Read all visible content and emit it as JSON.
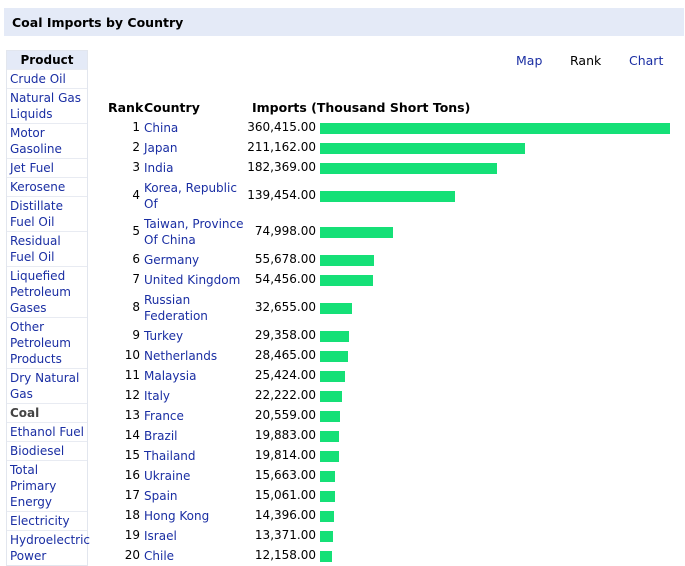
{
  "page_title": "Coal Imports by Country",
  "sidebar": {
    "header": "Product",
    "items": [
      {
        "label": "Crude Oil",
        "lines": 1
      },
      {
        "label": "Natural Gas Liquids",
        "lines": 2
      },
      {
        "label": "Motor Gasoline",
        "lines": 2
      },
      {
        "label": "Jet Fuel",
        "lines": 1
      },
      {
        "label": "Kerosene",
        "lines": 1
      },
      {
        "label": "Distillate Fuel Oil",
        "lines": 2
      },
      {
        "label": "Residual Fuel Oil",
        "lines": 2
      },
      {
        "label": "Liquefied Petroleum Gases",
        "lines": 3
      },
      {
        "label": "Other Petroleum Products",
        "lines": 3
      },
      {
        "label": "Dry Natural Gas",
        "lines": 2
      },
      {
        "label": "Coal",
        "lines": 1,
        "current": true
      },
      {
        "label": "Ethanol Fuel",
        "lines": 1
      },
      {
        "label": "Biodiesel",
        "lines": 1
      },
      {
        "label": "Total Primary Energy",
        "lines": 3
      },
      {
        "label": "Electricity",
        "lines": 1
      },
      {
        "label": "Hydroelectric Power",
        "lines": 2
      }
    ]
  },
  "view_nav": {
    "map": "Map",
    "rank": "Rank",
    "chart": "Chart",
    "active": "rank"
  },
  "table": {
    "header_rank": "Rank",
    "header_country": "Country",
    "header_imports": "Imports (Thousand Short Tons)",
    "max_value": 360415,
    "rows": [
      {
        "rank": "1",
        "country": "China",
        "value": "360,415.00",
        "v": 360415
      },
      {
        "rank": "2",
        "country": "Japan",
        "value": "211,162.00",
        "v": 211162
      },
      {
        "rank": "3",
        "country": "India",
        "value": "182,369.00",
        "v": 182369
      },
      {
        "rank": "4",
        "country": "Korea, Republic Of",
        "value": "139,454.00",
        "v": 139454,
        "lines": 2
      },
      {
        "rank": "5",
        "country": "Taiwan, Province Of China",
        "value": "74,998.00",
        "v": 74998,
        "lines": 2
      },
      {
        "rank": "6",
        "country": "Germany",
        "value": "55,678.00",
        "v": 55678
      },
      {
        "rank": "7",
        "country": "United Kingdom",
        "value": "54,456.00",
        "v": 54456
      },
      {
        "rank": "8",
        "country": "Russian Federation",
        "value": "32,655.00",
        "v": 32655,
        "lines": 2
      },
      {
        "rank": "9",
        "country": "Turkey",
        "value": "29,358.00",
        "v": 29358
      },
      {
        "rank": "10",
        "country": "Netherlands",
        "value": "28,465.00",
        "v": 28465
      },
      {
        "rank": "11",
        "country": "Malaysia",
        "value": "25,424.00",
        "v": 25424
      },
      {
        "rank": "12",
        "country": "Italy",
        "value": "22,222.00",
        "v": 22222
      },
      {
        "rank": "13",
        "country": "France",
        "value": "20,559.00",
        "v": 20559
      },
      {
        "rank": "14",
        "country": "Brazil",
        "value": "19,883.00",
        "v": 19883
      },
      {
        "rank": "15",
        "country": "Thailand",
        "value": "19,814.00",
        "v": 19814
      },
      {
        "rank": "16",
        "country": "Ukraine",
        "value": "15,663.00",
        "v": 15663
      },
      {
        "rank": "17",
        "country": "Spain",
        "value": "15,061.00",
        "v": 15061
      },
      {
        "rank": "18",
        "country": "Hong Kong",
        "value": "14,396.00",
        "v": 14396
      },
      {
        "rank": "19",
        "country": "Israel",
        "value": "13,371.00",
        "v": 13371
      },
      {
        "rank": "20",
        "country": "Chile",
        "value": "12,158.00",
        "v": 12158
      }
    ]
  },
  "colors": {
    "bar": "#15e077",
    "link": "#1a2ea3",
    "header_bg": "#e4eaf7"
  }
}
